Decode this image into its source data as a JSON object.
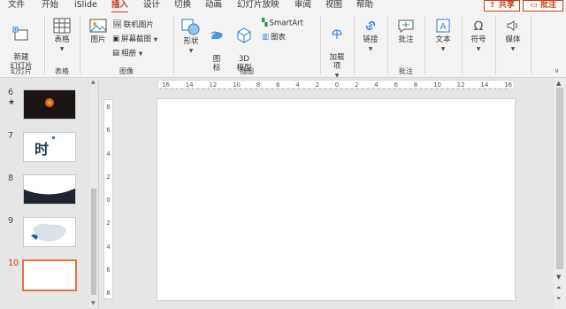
{
  "menu": {
    "tabs": [
      "文件",
      "开始",
      "iSlide",
      "插入",
      "设计",
      "切换",
      "动画",
      "幻灯片放映",
      "审阅",
      "视图",
      "帮助"
    ],
    "active": "插入",
    "share": "共享",
    "comment": "批注"
  },
  "ribbon": {
    "slides": {
      "new_slide": "新建\n幻灯片",
      "label": "幻灯片"
    },
    "tables": {
      "table": "表格",
      "label": "表格"
    },
    "images": {
      "picture": "图片",
      "online": "联机图片",
      "screenshot": "屏幕截图",
      "album": "相册",
      "label": "图像"
    },
    "illustrations": {
      "shapes": "形状",
      "icons": "图\n标",
      "model3d": "3D\n模型",
      "smartart": "SmartArt",
      "chart": "图表",
      "label": "插图"
    },
    "addins": {
      "addins": "加载\n项"
    },
    "links": {
      "link": "链接"
    },
    "comments": {
      "comment": "批注",
      "label": "批注"
    },
    "text": {
      "text": "文本"
    },
    "symbols": {
      "symbol": "符号"
    },
    "media": {
      "media": "媒体"
    }
  },
  "thumbnails": [
    {
      "number": "6",
      "starred": true,
      "star": "★"
    },
    {
      "number": "7",
      "starred": false,
      "text": "时"
    },
    {
      "number": "8",
      "starred": false
    },
    {
      "number": "9",
      "starred": false
    },
    {
      "number": "10",
      "starred": false,
      "active": true
    }
  ],
  "rulers": {
    "horizontal": "16 14 12 10 8 6 4 2 0 2 4 6 8 10 12 14 16",
    "vertical": [
      "8",
      "6",
      "4",
      "2",
      "0",
      "2",
      "4",
      "6",
      "8"
    ]
  },
  "colors": {
    "accent": "#c43e1c",
    "thumb_active": "#e8703f"
  }
}
